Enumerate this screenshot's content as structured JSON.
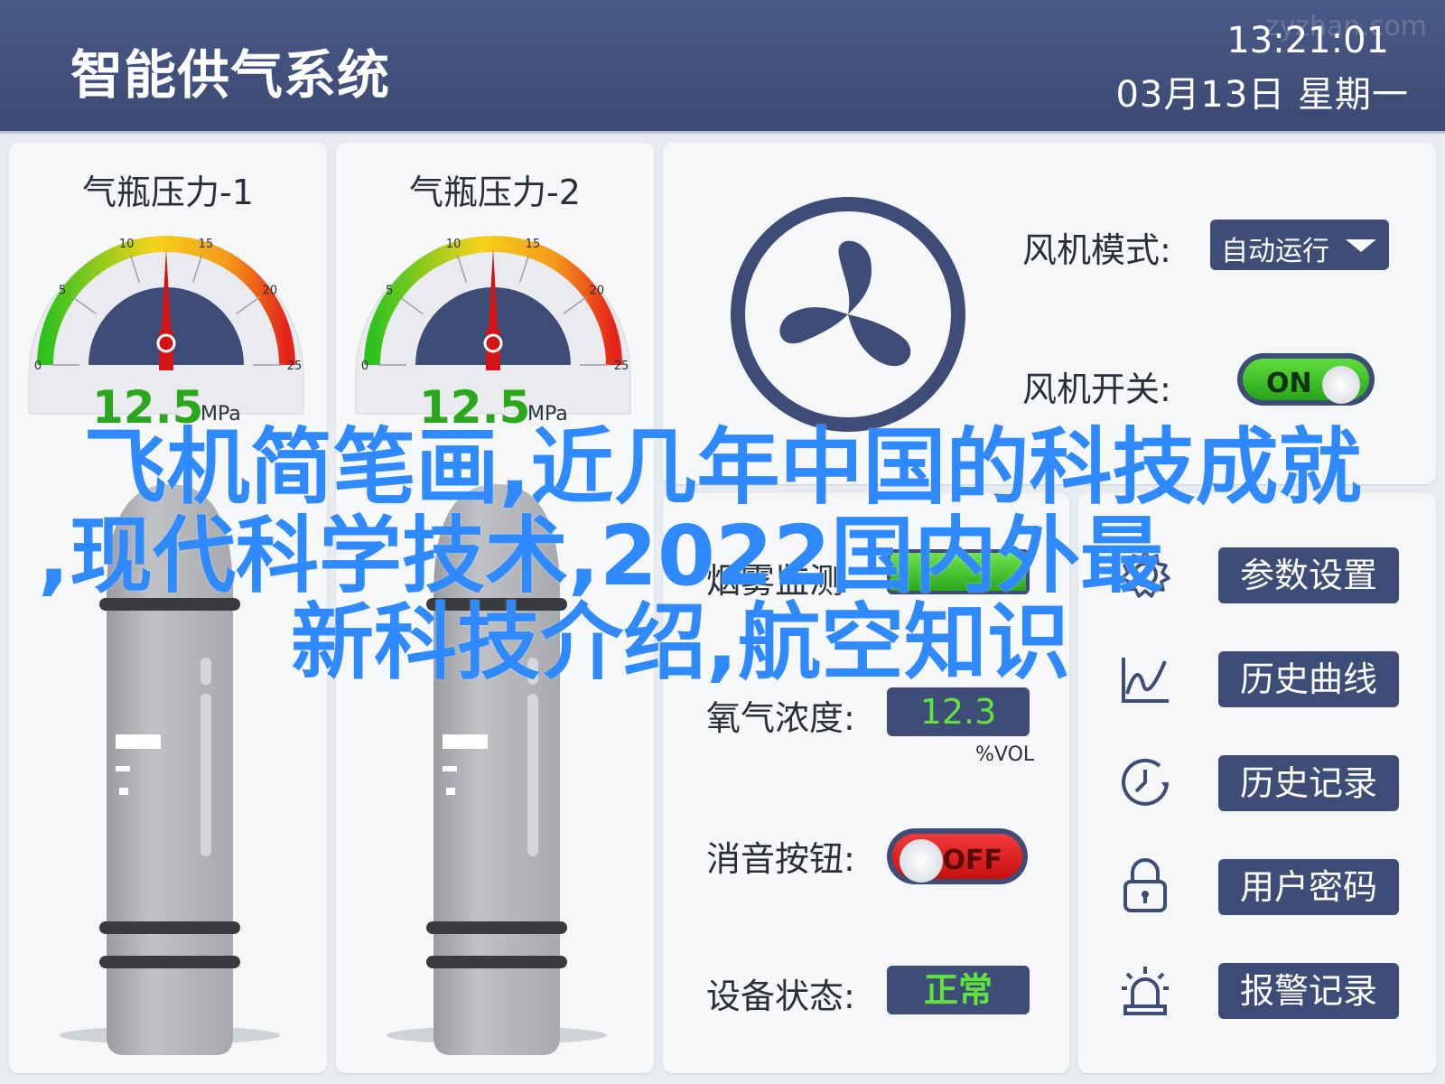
{
  "header": {
    "title": "智能供气系统",
    "time": "13:21:01",
    "date": "03月13日  星期一",
    "watermark": "zyzhan.com"
  },
  "gauges": [
    {
      "title": "气瓶压力-1",
      "value": "12.5",
      "unit": "MPa",
      "ticks": [
        "0",
        "5",
        "10",
        "15",
        "20",
        "25"
      ],
      "reading": 12.5,
      "max": 25
    },
    {
      "title": "气瓶压力-2",
      "value": "12.5",
      "unit": "MPa",
      "ticks": [
        "0",
        "5",
        "10",
        "15",
        "20",
        "25"
      ],
      "reading": 12.5,
      "max": 25
    }
  ],
  "fan": {
    "mode_label": "风机模式:",
    "mode_value": "自动运行",
    "switch_label": "风机开关:",
    "switch_value": "ON",
    "switch_on": true
  },
  "status": {
    "smoke_label": "烟雾监测",
    "oxygen_label": "氧气浓度:",
    "oxygen_value": "12.3",
    "oxygen_unit": "%VOL",
    "mute_label": "消音按钮:",
    "mute_value": "OFF",
    "device_label": "设备状态:",
    "device_value": "正常"
  },
  "side_menu": [
    {
      "label": "参数设置",
      "icon": "gear-icon"
    },
    {
      "label": "历史曲线",
      "icon": "chart-icon"
    },
    {
      "label": "历史记录",
      "icon": "clock-icon"
    },
    {
      "label": "用户密码",
      "icon": "lock-icon"
    },
    {
      "label": "报警记录",
      "icon": "alarm-icon"
    }
  ],
  "overlay": {
    "line1": "飞机简笔画,近几年中国的科技成就",
    "line2": ",现代科学技术,2022国内外最",
    "line3": "新科技介绍,航空知识"
  },
  "colors": {
    "header": "#3d4d78",
    "accent_green": "#5fe23c",
    "accent_red": "#d21414",
    "overlay_text": "#2f89ff"
  }
}
